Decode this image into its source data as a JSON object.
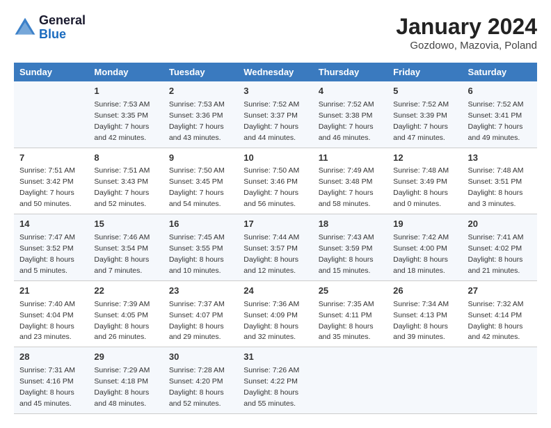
{
  "logo": {
    "line1": "General",
    "line2": "Blue"
  },
  "title": "January 2024",
  "subtitle": "Gozdowo, Mazovia, Poland",
  "days_of_week": [
    "Sunday",
    "Monday",
    "Tuesday",
    "Wednesday",
    "Thursday",
    "Friday",
    "Saturday"
  ],
  "weeks": [
    [
      {
        "num": "",
        "sunrise": "",
        "sunset": "",
        "daylight": ""
      },
      {
        "num": "1",
        "sunrise": "Sunrise: 7:53 AM",
        "sunset": "Sunset: 3:35 PM",
        "daylight": "Daylight: 7 hours and 42 minutes."
      },
      {
        "num": "2",
        "sunrise": "Sunrise: 7:53 AM",
        "sunset": "Sunset: 3:36 PM",
        "daylight": "Daylight: 7 hours and 43 minutes."
      },
      {
        "num": "3",
        "sunrise": "Sunrise: 7:52 AM",
        "sunset": "Sunset: 3:37 PM",
        "daylight": "Daylight: 7 hours and 44 minutes."
      },
      {
        "num": "4",
        "sunrise": "Sunrise: 7:52 AM",
        "sunset": "Sunset: 3:38 PM",
        "daylight": "Daylight: 7 hours and 46 minutes."
      },
      {
        "num": "5",
        "sunrise": "Sunrise: 7:52 AM",
        "sunset": "Sunset: 3:39 PM",
        "daylight": "Daylight: 7 hours and 47 minutes."
      },
      {
        "num": "6",
        "sunrise": "Sunrise: 7:52 AM",
        "sunset": "Sunset: 3:41 PM",
        "daylight": "Daylight: 7 hours and 49 minutes."
      }
    ],
    [
      {
        "num": "7",
        "sunrise": "Sunrise: 7:51 AM",
        "sunset": "Sunset: 3:42 PM",
        "daylight": "Daylight: 7 hours and 50 minutes."
      },
      {
        "num": "8",
        "sunrise": "Sunrise: 7:51 AM",
        "sunset": "Sunset: 3:43 PM",
        "daylight": "Daylight: 7 hours and 52 minutes."
      },
      {
        "num": "9",
        "sunrise": "Sunrise: 7:50 AM",
        "sunset": "Sunset: 3:45 PM",
        "daylight": "Daylight: 7 hours and 54 minutes."
      },
      {
        "num": "10",
        "sunrise": "Sunrise: 7:50 AM",
        "sunset": "Sunset: 3:46 PM",
        "daylight": "Daylight: 7 hours and 56 minutes."
      },
      {
        "num": "11",
        "sunrise": "Sunrise: 7:49 AM",
        "sunset": "Sunset: 3:48 PM",
        "daylight": "Daylight: 7 hours and 58 minutes."
      },
      {
        "num": "12",
        "sunrise": "Sunrise: 7:48 AM",
        "sunset": "Sunset: 3:49 PM",
        "daylight": "Daylight: 8 hours and 0 minutes."
      },
      {
        "num": "13",
        "sunrise": "Sunrise: 7:48 AM",
        "sunset": "Sunset: 3:51 PM",
        "daylight": "Daylight: 8 hours and 3 minutes."
      }
    ],
    [
      {
        "num": "14",
        "sunrise": "Sunrise: 7:47 AM",
        "sunset": "Sunset: 3:52 PM",
        "daylight": "Daylight: 8 hours and 5 minutes."
      },
      {
        "num": "15",
        "sunrise": "Sunrise: 7:46 AM",
        "sunset": "Sunset: 3:54 PM",
        "daylight": "Daylight: 8 hours and 7 minutes."
      },
      {
        "num": "16",
        "sunrise": "Sunrise: 7:45 AM",
        "sunset": "Sunset: 3:55 PM",
        "daylight": "Daylight: 8 hours and 10 minutes."
      },
      {
        "num": "17",
        "sunrise": "Sunrise: 7:44 AM",
        "sunset": "Sunset: 3:57 PM",
        "daylight": "Daylight: 8 hours and 12 minutes."
      },
      {
        "num": "18",
        "sunrise": "Sunrise: 7:43 AM",
        "sunset": "Sunset: 3:59 PM",
        "daylight": "Daylight: 8 hours and 15 minutes."
      },
      {
        "num": "19",
        "sunrise": "Sunrise: 7:42 AM",
        "sunset": "Sunset: 4:00 PM",
        "daylight": "Daylight: 8 hours and 18 minutes."
      },
      {
        "num": "20",
        "sunrise": "Sunrise: 7:41 AM",
        "sunset": "Sunset: 4:02 PM",
        "daylight": "Daylight: 8 hours and 21 minutes."
      }
    ],
    [
      {
        "num": "21",
        "sunrise": "Sunrise: 7:40 AM",
        "sunset": "Sunset: 4:04 PM",
        "daylight": "Daylight: 8 hours and 23 minutes."
      },
      {
        "num": "22",
        "sunrise": "Sunrise: 7:39 AM",
        "sunset": "Sunset: 4:05 PM",
        "daylight": "Daylight: 8 hours and 26 minutes."
      },
      {
        "num": "23",
        "sunrise": "Sunrise: 7:37 AM",
        "sunset": "Sunset: 4:07 PM",
        "daylight": "Daylight: 8 hours and 29 minutes."
      },
      {
        "num": "24",
        "sunrise": "Sunrise: 7:36 AM",
        "sunset": "Sunset: 4:09 PM",
        "daylight": "Daylight: 8 hours and 32 minutes."
      },
      {
        "num": "25",
        "sunrise": "Sunrise: 7:35 AM",
        "sunset": "Sunset: 4:11 PM",
        "daylight": "Daylight: 8 hours and 35 minutes."
      },
      {
        "num": "26",
        "sunrise": "Sunrise: 7:34 AM",
        "sunset": "Sunset: 4:13 PM",
        "daylight": "Daylight: 8 hours and 39 minutes."
      },
      {
        "num": "27",
        "sunrise": "Sunrise: 7:32 AM",
        "sunset": "Sunset: 4:14 PM",
        "daylight": "Daylight: 8 hours and 42 minutes."
      }
    ],
    [
      {
        "num": "28",
        "sunrise": "Sunrise: 7:31 AM",
        "sunset": "Sunset: 4:16 PM",
        "daylight": "Daylight: 8 hours and 45 minutes."
      },
      {
        "num": "29",
        "sunrise": "Sunrise: 7:29 AM",
        "sunset": "Sunset: 4:18 PM",
        "daylight": "Daylight: 8 hours and 48 minutes."
      },
      {
        "num": "30",
        "sunrise": "Sunrise: 7:28 AM",
        "sunset": "Sunset: 4:20 PM",
        "daylight": "Daylight: 8 hours and 52 minutes."
      },
      {
        "num": "31",
        "sunrise": "Sunrise: 7:26 AM",
        "sunset": "Sunset: 4:22 PM",
        "daylight": "Daylight: 8 hours and 55 minutes."
      },
      {
        "num": "",
        "sunrise": "",
        "sunset": "",
        "daylight": ""
      },
      {
        "num": "",
        "sunrise": "",
        "sunset": "",
        "daylight": ""
      },
      {
        "num": "",
        "sunrise": "",
        "sunset": "",
        "daylight": ""
      }
    ]
  ]
}
